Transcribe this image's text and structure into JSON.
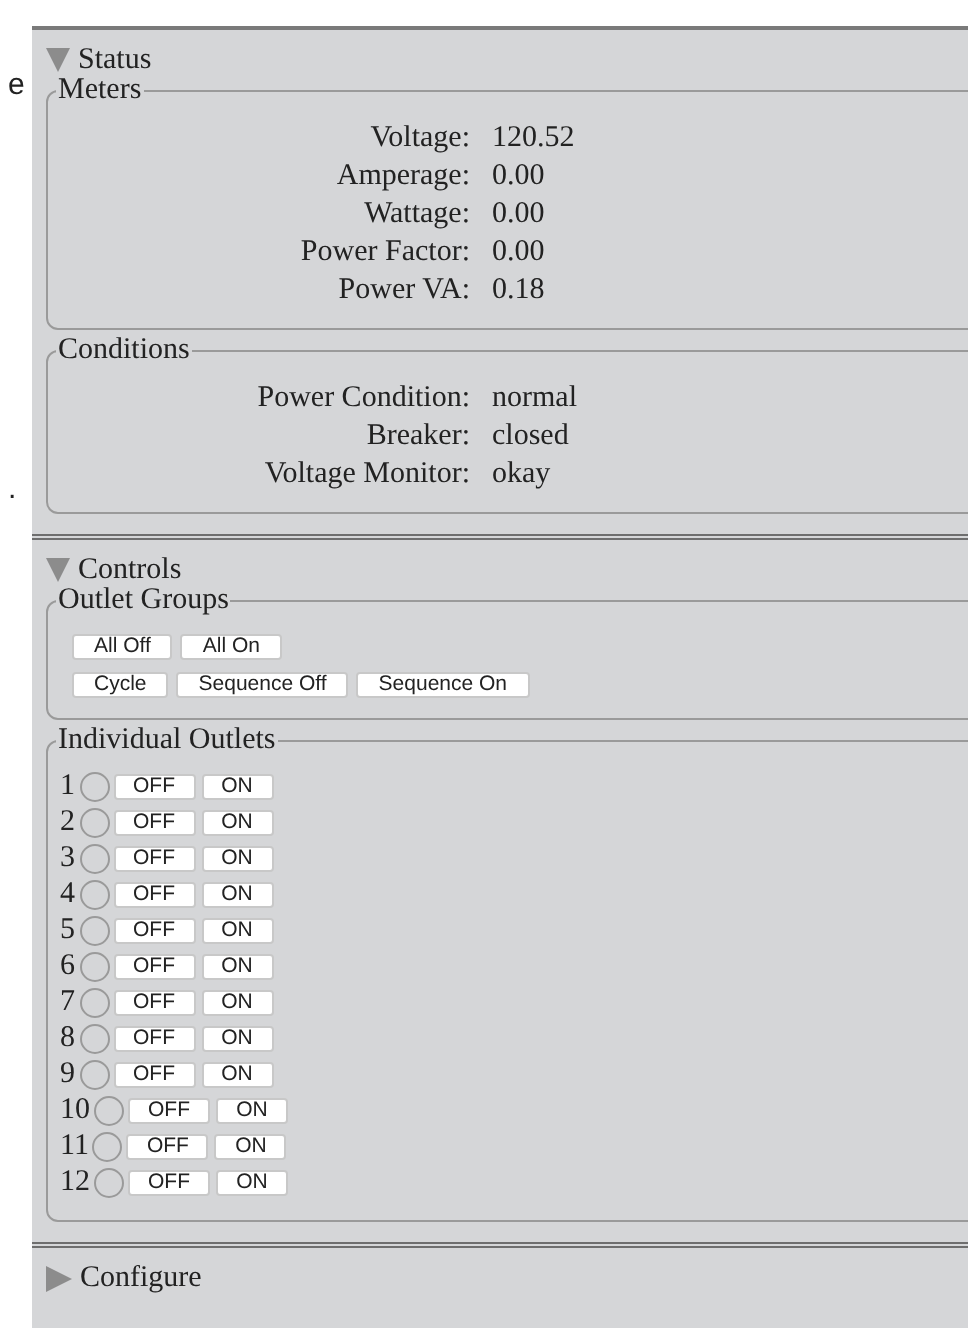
{
  "margin_text": [
    "e",
    "."
  ],
  "sections": [
    {
      "title": "Status",
      "expanded": true,
      "groups": [
        {
          "kind": "readings",
          "legend": "Meters",
          "rows": [
            {
              "label": "Voltage:",
              "value": "120.52"
            },
            {
              "label": "Amperage:",
              "value": "0.00"
            },
            {
              "label": "Wattage:",
              "value": "0.00"
            },
            {
              "label": "Power Factor:",
              "value": "0.00"
            },
            {
              "label": "Power VA:",
              "value": "0.18"
            }
          ]
        },
        {
          "kind": "readings",
          "legend": "Conditions",
          "rows": [
            {
              "label": "Power Condition:",
              "value": "normal"
            },
            {
              "label": "Breaker:",
              "value": "closed"
            },
            {
              "label": "Voltage Monitor:",
              "value": "okay"
            }
          ]
        }
      ]
    },
    {
      "title": "Controls",
      "expanded": true,
      "groups": [
        {
          "kind": "buttons",
          "legend": "Outlet Groups",
          "button_rows": [
            [
              "All Off",
              "All On"
            ],
            [
              "Cycle",
              "Sequence Off",
              "Sequence On"
            ]
          ]
        },
        {
          "kind": "outlets",
          "legend": "Individual Outlets",
          "outlets": [
            {
              "number": "1",
              "on": false,
              "off_label": "OFF",
              "on_label": "ON"
            },
            {
              "number": "2",
              "on": false,
              "off_label": "OFF",
              "on_label": "ON"
            },
            {
              "number": "3",
              "on": false,
              "off_label": "OFF",
              "on_label": "ON"
            },
            {
              "number": "4",
              "on": false,
              "off_label": "OFF",
              "on_label": "ON"
            },
            {
              "number": "5",
              "on": false,
              "off_label": "OFF",
              "on_label": "ON"
            },
            {
              "number": "6",
              "on": false,
              "off_label": "OFF",
              "on_label": "ON"
            },
            {
              "number": "7",
              "on": false,
              "off_label": "OFF",
              "on_label": "ON"
            },
            {
              "number": "8",
              "on": false,
              "off_label": "OFF",
              "on_label": "ON"
            },
            {
              "number": "9",
              "on": false,
              "off_label": "OFF",
              "on_label": "ON"
            },
            {
              "number": "10",
              "on": false,
              "off_label": "OFF",
              "on_label": "ON"
            },
            {
              "number": "11",
              "on": false,
              "off_label": "OFF",
              "on_label": "ON"
            },
            {
              "number": "12",
              "on": false,
              "off_label": "OFF",
              "on_label": "ON"
            }
          ]
        }
      ]
    },
    {
      "title": "Configure",
      "expanded": false
    }
  ]
}
